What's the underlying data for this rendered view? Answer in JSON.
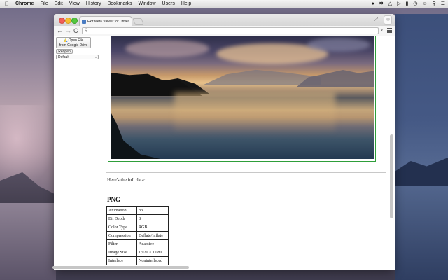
{
  "menubar": {
    "app": "Chrome",
    "items": [
      "File",
      "Edit",
      "View",
      "History",
      "Bookmarks",
      "Window",
      "Users",
      "Help"
    ],
    "tray_icons": [
      "evernote-icon",
      "bluetooth-icon",
      "wifi-icon",
      "volume-icon",
      "battery-icon",
      "clock-icon",
      "user-icon",
      "search-icon",
      "list-icon"
    ]
  },
  "tab": {
    "title": "Exif Meta Viewer for Drive",
    "close": "×"
  },
  "toolbar": {
    "back": "←",
    "forward": "→",
    "reload": "C",
    "omnibox_icon": "🔍",
    "clear": "×"
  },
  "panel": {
    "open_file_line1": "Open File",
    "open_file_line2": "from Google Drive",
    "reopen": "Reopen",
    "select_value": "Default"
  },
  "content": {
    "intro": "Here's the full data:",
    "section": "PNG",
    "table": [
      {
        "key": "Animation",
        "value": "no"
      },
      {
        "key": "Bit Depth",
        "value": "8"
      },
      {
        "key": "Color Type",
        "value": "RGB"
      },
      {
        "key": "Compression",
        "value": "Deflate/Inflate"
      },
      {
        "key": "Filter",
        "value": "Adaptive"
      },
      {
        "key": "Image Size",
        "value": "1,920 × 1,080"
      },
      {
        "key": "Interlace",
        "value": "Noninterlaced"
      }
    ]
  }
}
